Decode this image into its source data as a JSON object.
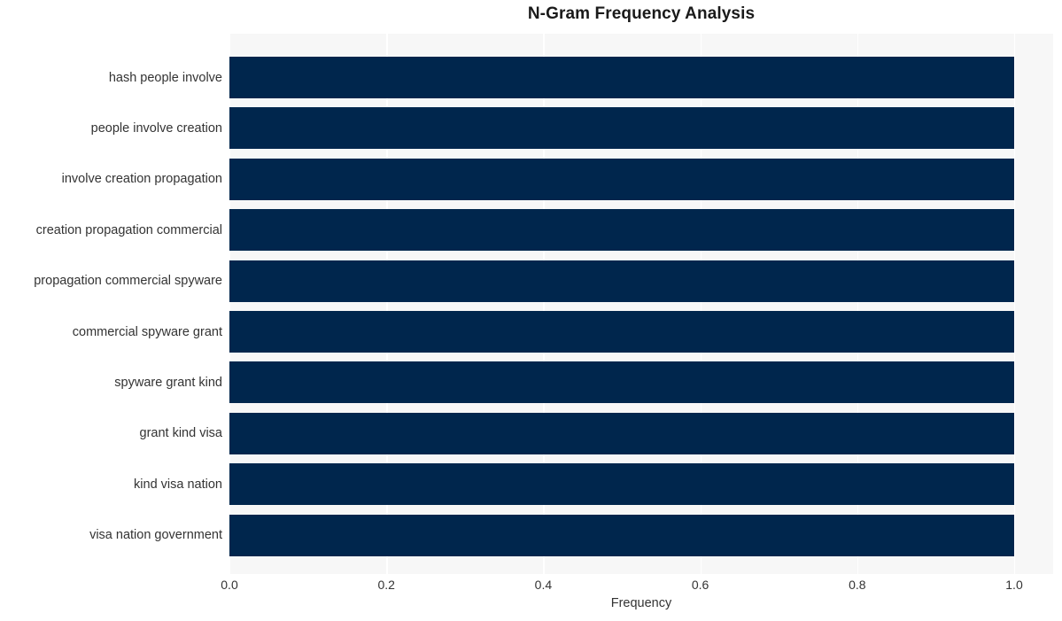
{
  "chart_data": {
    "type": "bar",
    "orientation": "horizontal",
    "title": "N-Gram Frequency Analysis",
    "xlabel": "Frequency",
    "ylabel": "",
    "categories": [
      "hash people involve",
      "people involve creation",
      "involve creation propagation",
      "creation propagation commercial",
      "propagation commercial spyware",
      "commercial spyware grant",
      "spyware grant kind",
      "grant kind visa",
      "kind visa nation",
      "visa nation government"
    ],
    "values": [
      1.0,
      1.0,
      1.0,
      1.0,
      1.0,
      1.0,
      1.0,
      1.0,
      1.0,
      1.0
    ],
    "xlim": [
      0.0,
      1.0
    ],
    "xticks": [
      0.0,
      0.2,
      0.4,
      0.6,
      0.8,
      1.0
    ],
    "xtick_labels": [
      "0.0",
      "0.2",
      "0.4",
      "0.6",
      "0.8",
      "1.0"
    ],
    "grid": true,
    "grid_axis": "x",
    "legend": false,
    "bar_color": "#00264d",
    "plot_background": "#f7f7f7",
    "gridline_color": "#ffffff",
    "figure_background": "#ffffff",
    "text_color": "#333333"
  }
}
